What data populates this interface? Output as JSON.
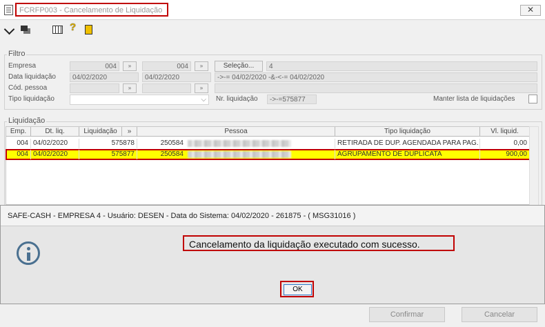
{
  "window": {
    "title": "FCRFP003 - Cancelamento de Liquidação",
    "close_symbol": "✕"
  },
  "toolbar": {
    "help_symbol": "?"
  },
  "filtro": {
    "legend": "Filtro",
    "empresa_label": "Empresa",
    "empresa_from": "004",
    "empresa_to": "004",
    "selecao_button": "Seleção...",
    "selecao_value": "4",
    "data_label": "Data liquidação",
    "data_from": "04/02/2020",
    "data_to": "04/02/2020",
    "data_expr": "->-= 04/02/2020 -&-<-= 04/02/2020",
    "cod_pessoa_label": "Cód. pessoa",
    "tipo_label": "Tipo liquidação",
    "nr_label": "Nr. liquidação",
    "nr_value": "->-=575877",
    "manter_label": "Manter lista de liquidações"
  },
  "liquidacao": {
    "legend": "Liquidação",
    "columns": [
      "Emp.",
      "Dt. liq.",
      "Liquidação",
      "Pessoa",
      "Tipo liquidação",
      "Vl. liquid."
    ],
    "rows": [
      {
        "emp": "004",
        "dt": "04/02/2020",
        "liq": "575878",
        "pessoa_cod": "250584",
        "tipo": "RETIRADA DE DUP. AGENDADA PARA PAG.",
        "valor": "0,00"
      },
      {
        "emp": "004",
        "dt": "04/02/2020",
        "liq": "575877",
        "pessoa_cod": "250584",
        "tipo": "AGRUPAMENTO DE DUPLICATA",
        "valor": "900,00"
      }
    ]
  },
  "dialog": {
    "title": "SAFE-CASH - EMPRESA 4 - Usuário: DESEN - Data do Sistema: 04/02/2020 - 261875 - ( MSG31016 )",
    "message": "Cancelamento da liquidação executado com sucesso.",
    "ok_label": "OK"
  },
  "footer": {
    "confirmar": "Confirmar",
    "cancelar": "Cancelar"
  },
  "colors": {
    "highlight_row": "#ffff00",
    "annotation_red": "#c00000"
  }
}
